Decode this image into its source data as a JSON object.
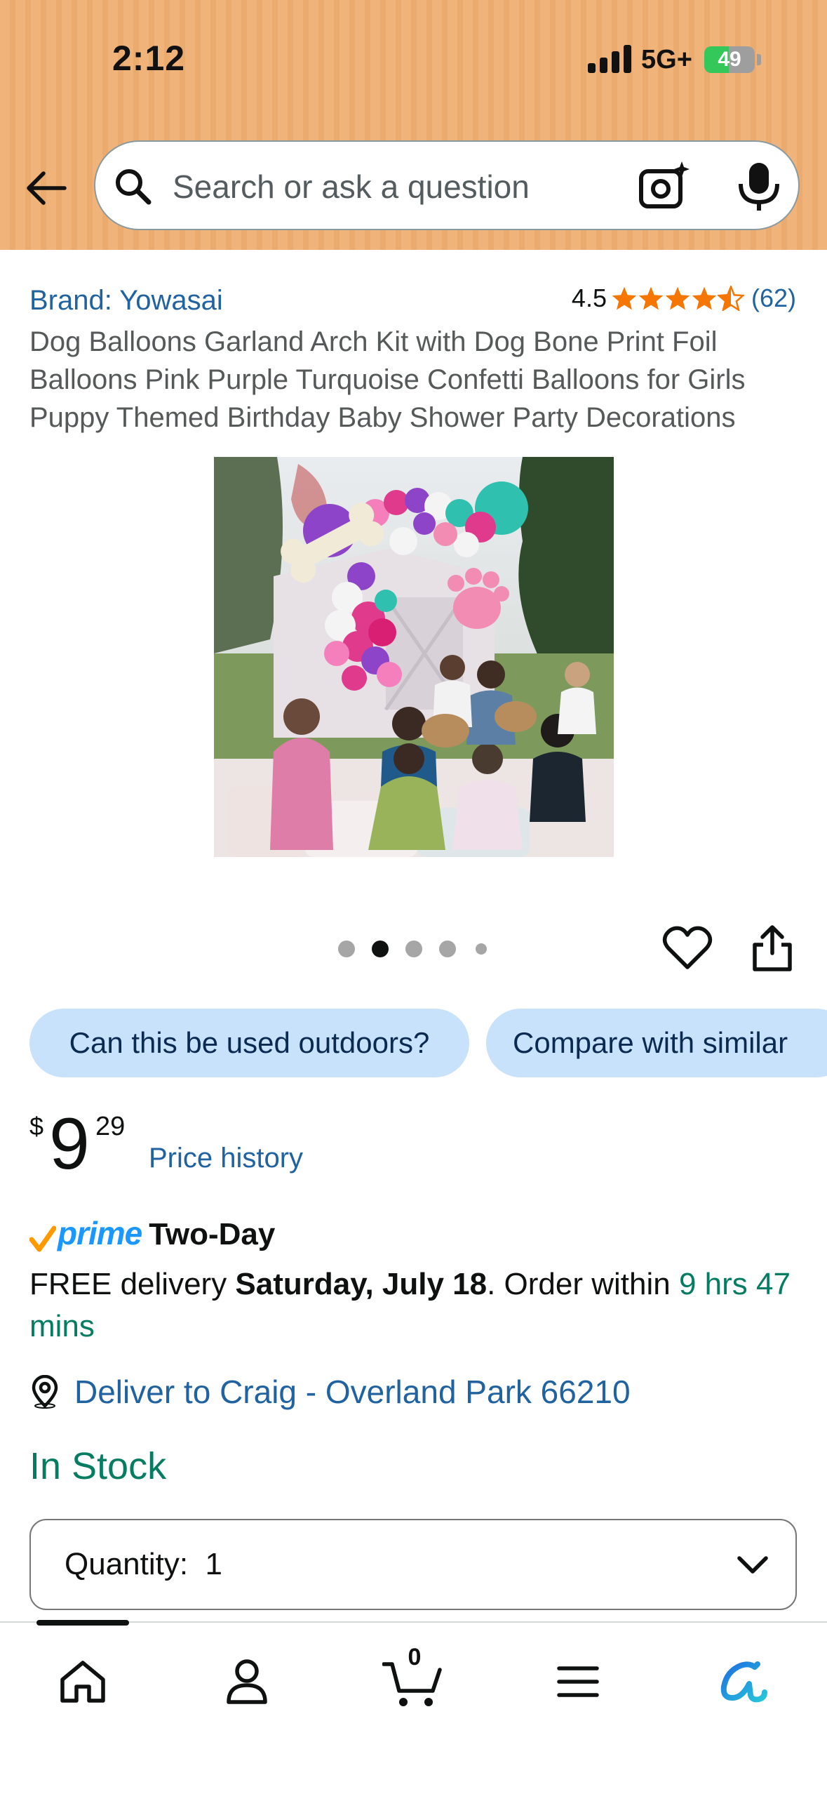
{
  "status_bar": {
    "time": "2:12",
    "network": "5G+",
    "battery_level": "49",
    "battery_fraction": 0.49
  },
  "header": {
    "search_placeholder": "Search or ask a question",
    "background_color": "#f0b47a"
  },
  "product": {
    "brand": "Brand: Yowasai",
    "rating": "4.5",
    "rating_stars": 4.5,
    "review_count": "(62)",
    "title": "Dog Balloons Garland Arch Kit with Dog Bone Print Foil Balloons Pink Purple Turquoise Confetti Balloons for Girls Puppy Themed Birthday Baby Shower Party Decorations",
    "image_count": 5,
    "active_image": 2
  },
  "chips": [
    {
      "label": "Can this be used outdoors?"
    },
    {
      "label": "Compare with similar"
    }
  ],
  "price": {
    "currency": "$",
    "whole": "9",
    "fraction": "29",
    "history_link": "Price history"
  },
  "delivery": {
    "prime_word": "prime",
    "prime_speed": "Two-Day",
    "free_delivery": "FREE delivery ",
    "date": "Saturday, July 18",
    "order_within": ". Order within ",
    "countdown": "9 hrs 47 mins",
    "location": "Deliver to Craig - Overland Park 66210"
  },
  "stock_status": "In Stock",
  "quantity": {
    "label": "Quantity:",
    "value": "1"
  },
  "bottom_nav": {
    "cart_count": "0",
    "items": [
      "home-icon",
      "account-icon",
      "cart-icon",
      "menu-icon",
      "rufus-icon"
    ]
  },
  "colors": {
    "link": "#2162a1",
    "green": "#067d62",
    "star": "#f57600",
    "chip_bg": "#c9e2fb",
    "prime_blue": "#1a98ff",
    "prime_check": "#ff9900"
  }
}
